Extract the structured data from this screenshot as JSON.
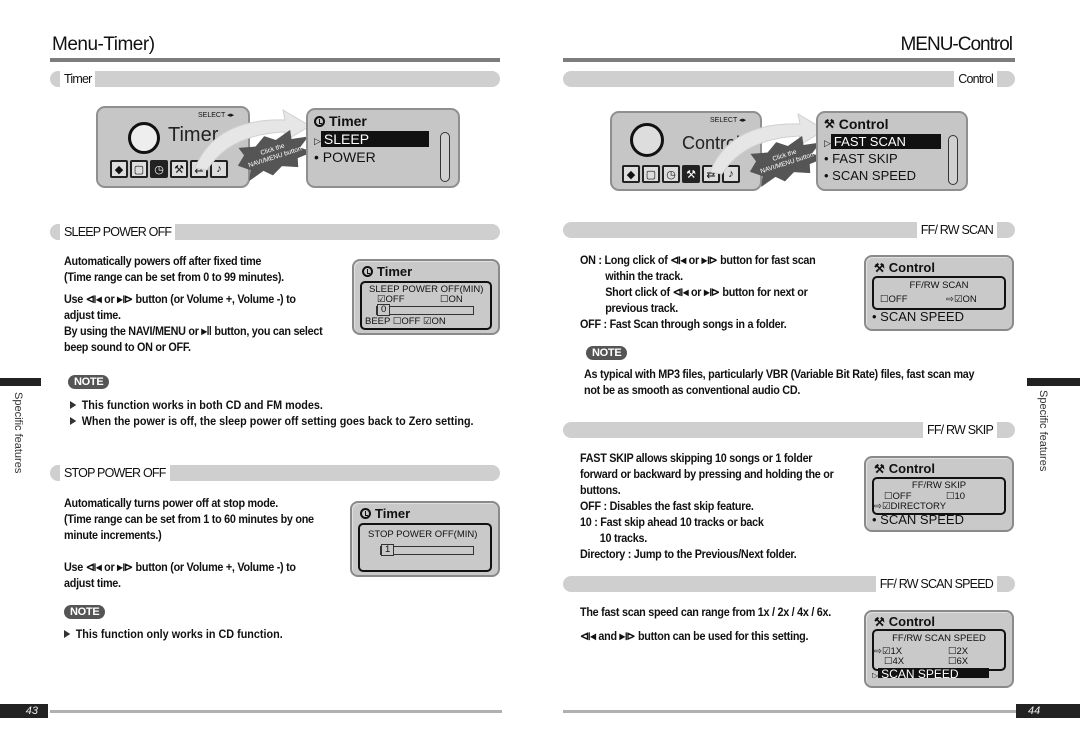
{
  "left_page": {
    "title": "Menu-Timer)",
    "section_timer": "Timer",
    "menu_screen": {
      "select_label": "SELECT ◂▸",
      "menu_name": "Timer",
      "burst_text": "Click the NAVI/MENU button",
      "icons": [
        "cd-icon",
        "monitor-icon",
        "clock-icon",
        "tools-icon",
        "repeat-icon",
        "music-note-icon"
      ],
      "active_icon": "clock-icon"
    },
    "submenu_screen": {
      "header": "Timer",
      "items": [
        {
          "label": "SLEEP",
          "selected": true
        },
        {
          "label": "POWER",
          "selected": false
        }
      ]
    },
    "sleep_section": {
      "label": "SLEEP POWER OFF",
      "lines": [
        "Automatically powers off after fixed time",
        "(Time range can be set from 0 to 99 minutes).",
        "Use ⧏◂ or ▸⧐ button (or Volume +, Volume -) to",
        "adjust time.",
        "By using the NAVI/MENU or ▸‖ button, you can select",
        "beep sound to ON or OFF."
      ],
      "lcd": {
        "header": "Timer",
        "title": "SLEEP POWER OFF(MIN)",
        "opt_off": "☑OFF",
        "opt_on": "☐ON",
        "value": "0",
        "beep": "BEEP ☐OFF ☑ON"
      },
      "note_label": "NOTE",
      "notes": [
        "This function works in both CD and FM modes.",
        "When the power is off, the sleep power off setting goes back to Zero setting."
      ]
    },
    "stop_section": {
      "label": "STOP POWER OFF",
      "lines": [
        "Automatically turns power off at stop mode.",
        "(Time range can be set from 1 to 60 minutes by one",
        "minute increments.)",
        "Use ⧏◂ or ▸⧐ button (or Volume +, Volume -) to",
        "adjust time."
      ],
      "lcd": {
        "header": "Timer",
        "title": "STOP POWER OFF(MIN)",
        "value": "1"
      },
      "note_label": "NOTE",
      "notes": [
        "This function only works in CD function."
      ]
    },
    "side_label": "Specific features",
    "page_number": "43"
  },
  "right_page": {
    "title": "MENU-Control",
    "section_control": "Control",
    "menu_screen": {
      "select_label": "SELECT ◂▸",
      "menu_name": "Control",
      "burst_text": "Click the NAVI/MENU button",
      "icons": [
        "cd-icon",
        "monitor-icon",
        "clock-icon",
        "tools-icon",
        "repeat-icon",
        "music-note-icon"
      ],
      "active_icon": "tools-icon"
    },
    "submenu_screen": {
      "header": "Control",
      "items": [
        {
          "label": "FAST SCAN",
          "selected": true
        },
        {
          "label": "FAST SKIP",
          "selected": false
        },
        {
          "label": "SCAN SPEED",
          "selected": false
        }
      ]
    },
    "scan_section": {
      "label": "FF/ RW SCAN",
      "lines": [
        "ON : Long click of ⧏◂ or ▸⧐ button for fast scan",
        "within the track.",
        "Short click of ⧏◂ or ▸⧐ button for next or",
        "previous track.",
        "OFF : Fast Scan through songs in a folder."
      ],
      "lcd": {
        "header": "Control",
        "title": "FF/RW SCAN",
        "opt_off": "☐OFF",
        "opt_on": "⇨☑ON",
        "footer": "• SCAN SPEED"
      },
      "note_label": "NOTE",
      "notes": [
        "As typical with MP3 files, particularly VBR (Variable Bit Rate) files, fast scan may",
        "not be as smooth as conventional audio CD."
      ]
    },
    "skip_section": {
      "label": "FF/ RW SKIP",
      "lines": [
        "FAST SKIP allows skipping 10 songs or 1 folder",
        "forward or backward by pressing and holding the or",
        "buttons.",
        "OFF : Disables the fast skip feature.",
        "10 : Fast skip ahead 10 tracks or back",
        "10 tracks.",
        "Directory : Jump to the Previous/Next folder."
      ],
      "lcd": {
        "header": "Control",
        "title": "FF/RW SKIP",
        "opt_off": "☐OFF",
        "opt_10": "☐10",
        "opt_dir": "⇨☑DIRECTORY",
        "footer": "• SCAN SPEED"
      }
    },
    "speed_section": {
      "label": "FF/ RW SCAN SPEED",
      "lines": [
        "The fast scan speed can range from 1x / 2x / 4x / 6x.",
        "⧏◂ and ▸⧐ button can be used for this setting."
      ],
      "lcd": {
        "header": "Control",
        "title": "FF/RW SCAN SPEED",
        "opt_1x": "⇨☑1X",
        "opt_2x": "☐2X",
        "opt_4x": "☐4X",
        "opt_6x": "☐6X",
        "footer": "SCAN SPEED"
      }
    },
    "side_label": "Specific features",
    "page_number": "44"
  }
}
